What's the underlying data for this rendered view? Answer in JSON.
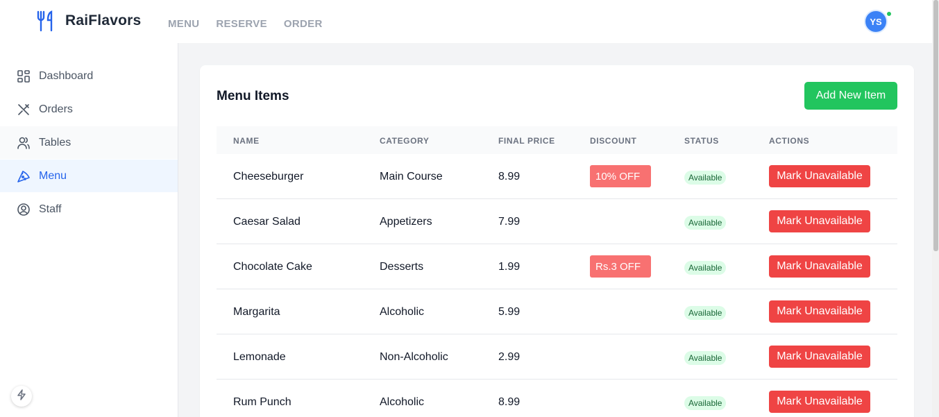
{
  "brand": {
    "name": "RaiFlavors",
    "icon": "utensils-icon"
  },
  "topnav": [
    "MENU",
    "RESERVE",
    "ORDER"
  ],
  "user": {
    "initials": "YS",
    "status_color": "#22c55e"
  },
  "sidebar": {
    "items": [
      {
        "label": "Dashboard",
        "icon": "grid-icon"
      },
      {
        "label": "Orders",
        "icon": "utensils-crossed-icon"
      },
      {
        "label": "Tables",
        "icon": "users-icon"
      },
      {
        "label": "Menu",
        "icon": "pizza-icon",
        "active": true
      },
      {
        "label": "Staff",
        "icon": "user-circle-icon"
      }
    ]
  },
  "main": {
    "title": "Menu Items",
    "add_button": "Add New Item",
    "columns": [
      "NAME",
      "CATEGORY",
      "FINAL PRICE",
      "DISCOUNT",
      "STATUS",
      "ACTIONS"
    ],
    "rows": [
      {
        "name": "Cheeseburger",
        "category": "Main Course",
        "price": "8.99",
        "discount": "10% OFF",
        "status": "Available",
        "action": "Mark Unavailable"
      },
      {
        "name": "Caesar Salad",
        "category": "Appetizers",
        "price": "7.99",
        "discount": "",
        "status": "Available",
        "action": "Mark Unavailable"
      },
      {
        "name": "Chocolate Cake",
        "category": "Desserts",
        "price": "1.99",
        "discount": "Rs.3 OFF",
        "status": "Available",
        "action": "Mark Unavailable"
      },
      {
        "name": "Margarita",
        "category": "Alcoholic",
        "price": "5.99",
        "discount": "",
        "status": "Available",
        "action": "Mark Unavailable"
      },
      {
        "name": "Lemonade",
        "category": "Non-Alcoholic",
        "price": "2.99",
        "discount": "",
        "status": "Available",
        "action": "Mark Unavailable"
      },
      {
        "name": "Rum Punch",
        "category": "Alcoholic",
        "price": "8.99",
        "discount": "",
        "status": "Available",
        "action": "Mark Unavailable"
      }
    ]
  },
  "colors": {
    "accent": "#2563eb",
    "add_button": "#22c55e",
    "danger": "#ef4444",
    "discount": "#f87171"
  }
}
